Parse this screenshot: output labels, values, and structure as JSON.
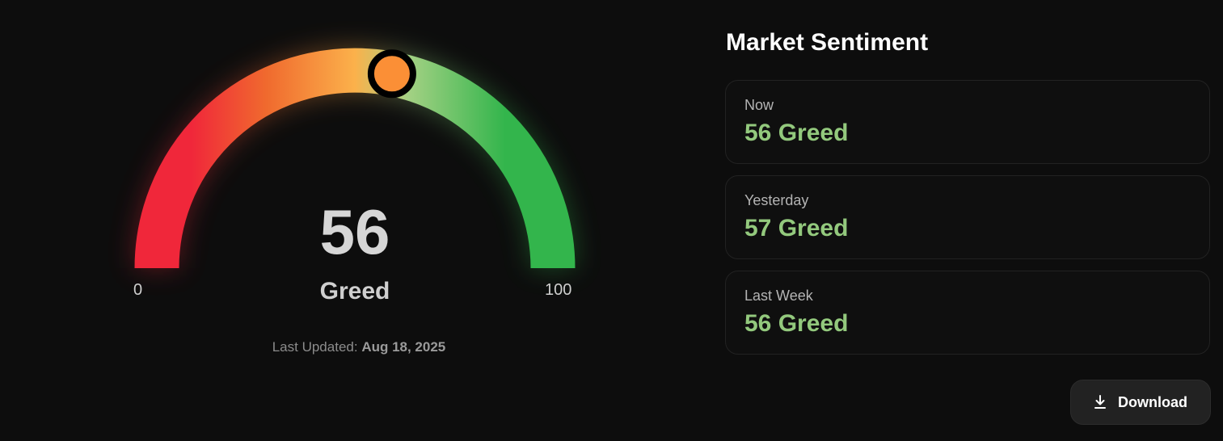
{
  "gauge": {
    "value": 56,
    "value_text": "56",
    "label": "Greed",
    "min": 0,
    "max": 100,
    "min_text": "0",
    "max_text": "100",
    "colors": {
      "fear": "#f0273a",
      "neutral": "#fbb14b",
      "greed": "#33b54c",
      "marker": "#fb8f36"
    }
  },
  "updated": {
    "prefix": "Last Updated:",
    "date": "Aug 18, 2025"
  },
  "panel": {
    "title": "Market Sentiment",
    "cards": [
      {
        "label": "Now",
        "value": "56 Greed"
      },
      {
        "label": "Yesterday",
        "value": "57 Greed"
      },
      {
        "label": "Last Week",
        "value": "56 Greed"
      }
    ]
  },
  "download": {
    "label": "Download",
    "icon": "download-icon"
  }
}
